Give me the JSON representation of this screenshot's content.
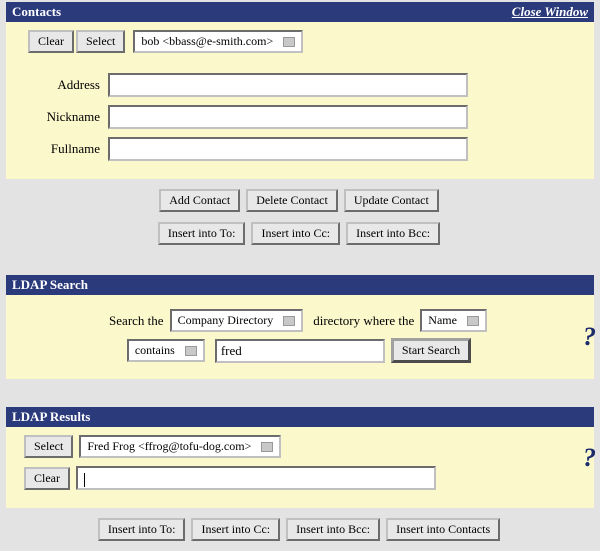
{
  "contacts": {
    "title": "Contacts",
    "close_label": "Close Window",
    "clear_label": "Clear",
    "select_label": "Select",
    "contact_selected": "bob <bbass@e-smith.com>",
    "address_label": "Address",
    "address_value": "",
    "nickname_label": "Nickname",
    "nickname_value": "",
    "fullname_label": "Fullname",
    "fullname_value": "",
    "add_contact_label": "Add Contact",
    "delete_contact_label": "Delete Contact",
    "update_contact_label": "Update Contact",
    "insert_to_label": "Insert into To:",
    "insert_cc_label": "Insert into Cc:",
    "insert_bcc_label": "Insert into Bcc:"
  },
  "ldap_search": {
    "title": "LDAP Search",
    "search_the_label": "Search the",
    "directory_option": "Company Directory",
    "directory_where_label": "directory where the",
    "field_option": "Name",
    "condition_option": "contains",
    "search_value": "fred",
    "start_search_label": "Start Search",
    "help_symbol": "?"
  },
  "ldap_results": {
    "title": "LDAP Results",
    "select_label": "Select",
    "result_selected": "Fred Frog <ffrog@tofu-dog.com>",
    "clear_label": "Clear",
    "input_value": "",
    "insert_to_label": "Insert into To:",
    "insert_cc_label": "Insert into Cc:",
    "insert_bcc_label": "Insert into Bcc:",
    "insert_contacts_label": "Insert into Contacts",
    "help_symbol": "?"
  }
}
